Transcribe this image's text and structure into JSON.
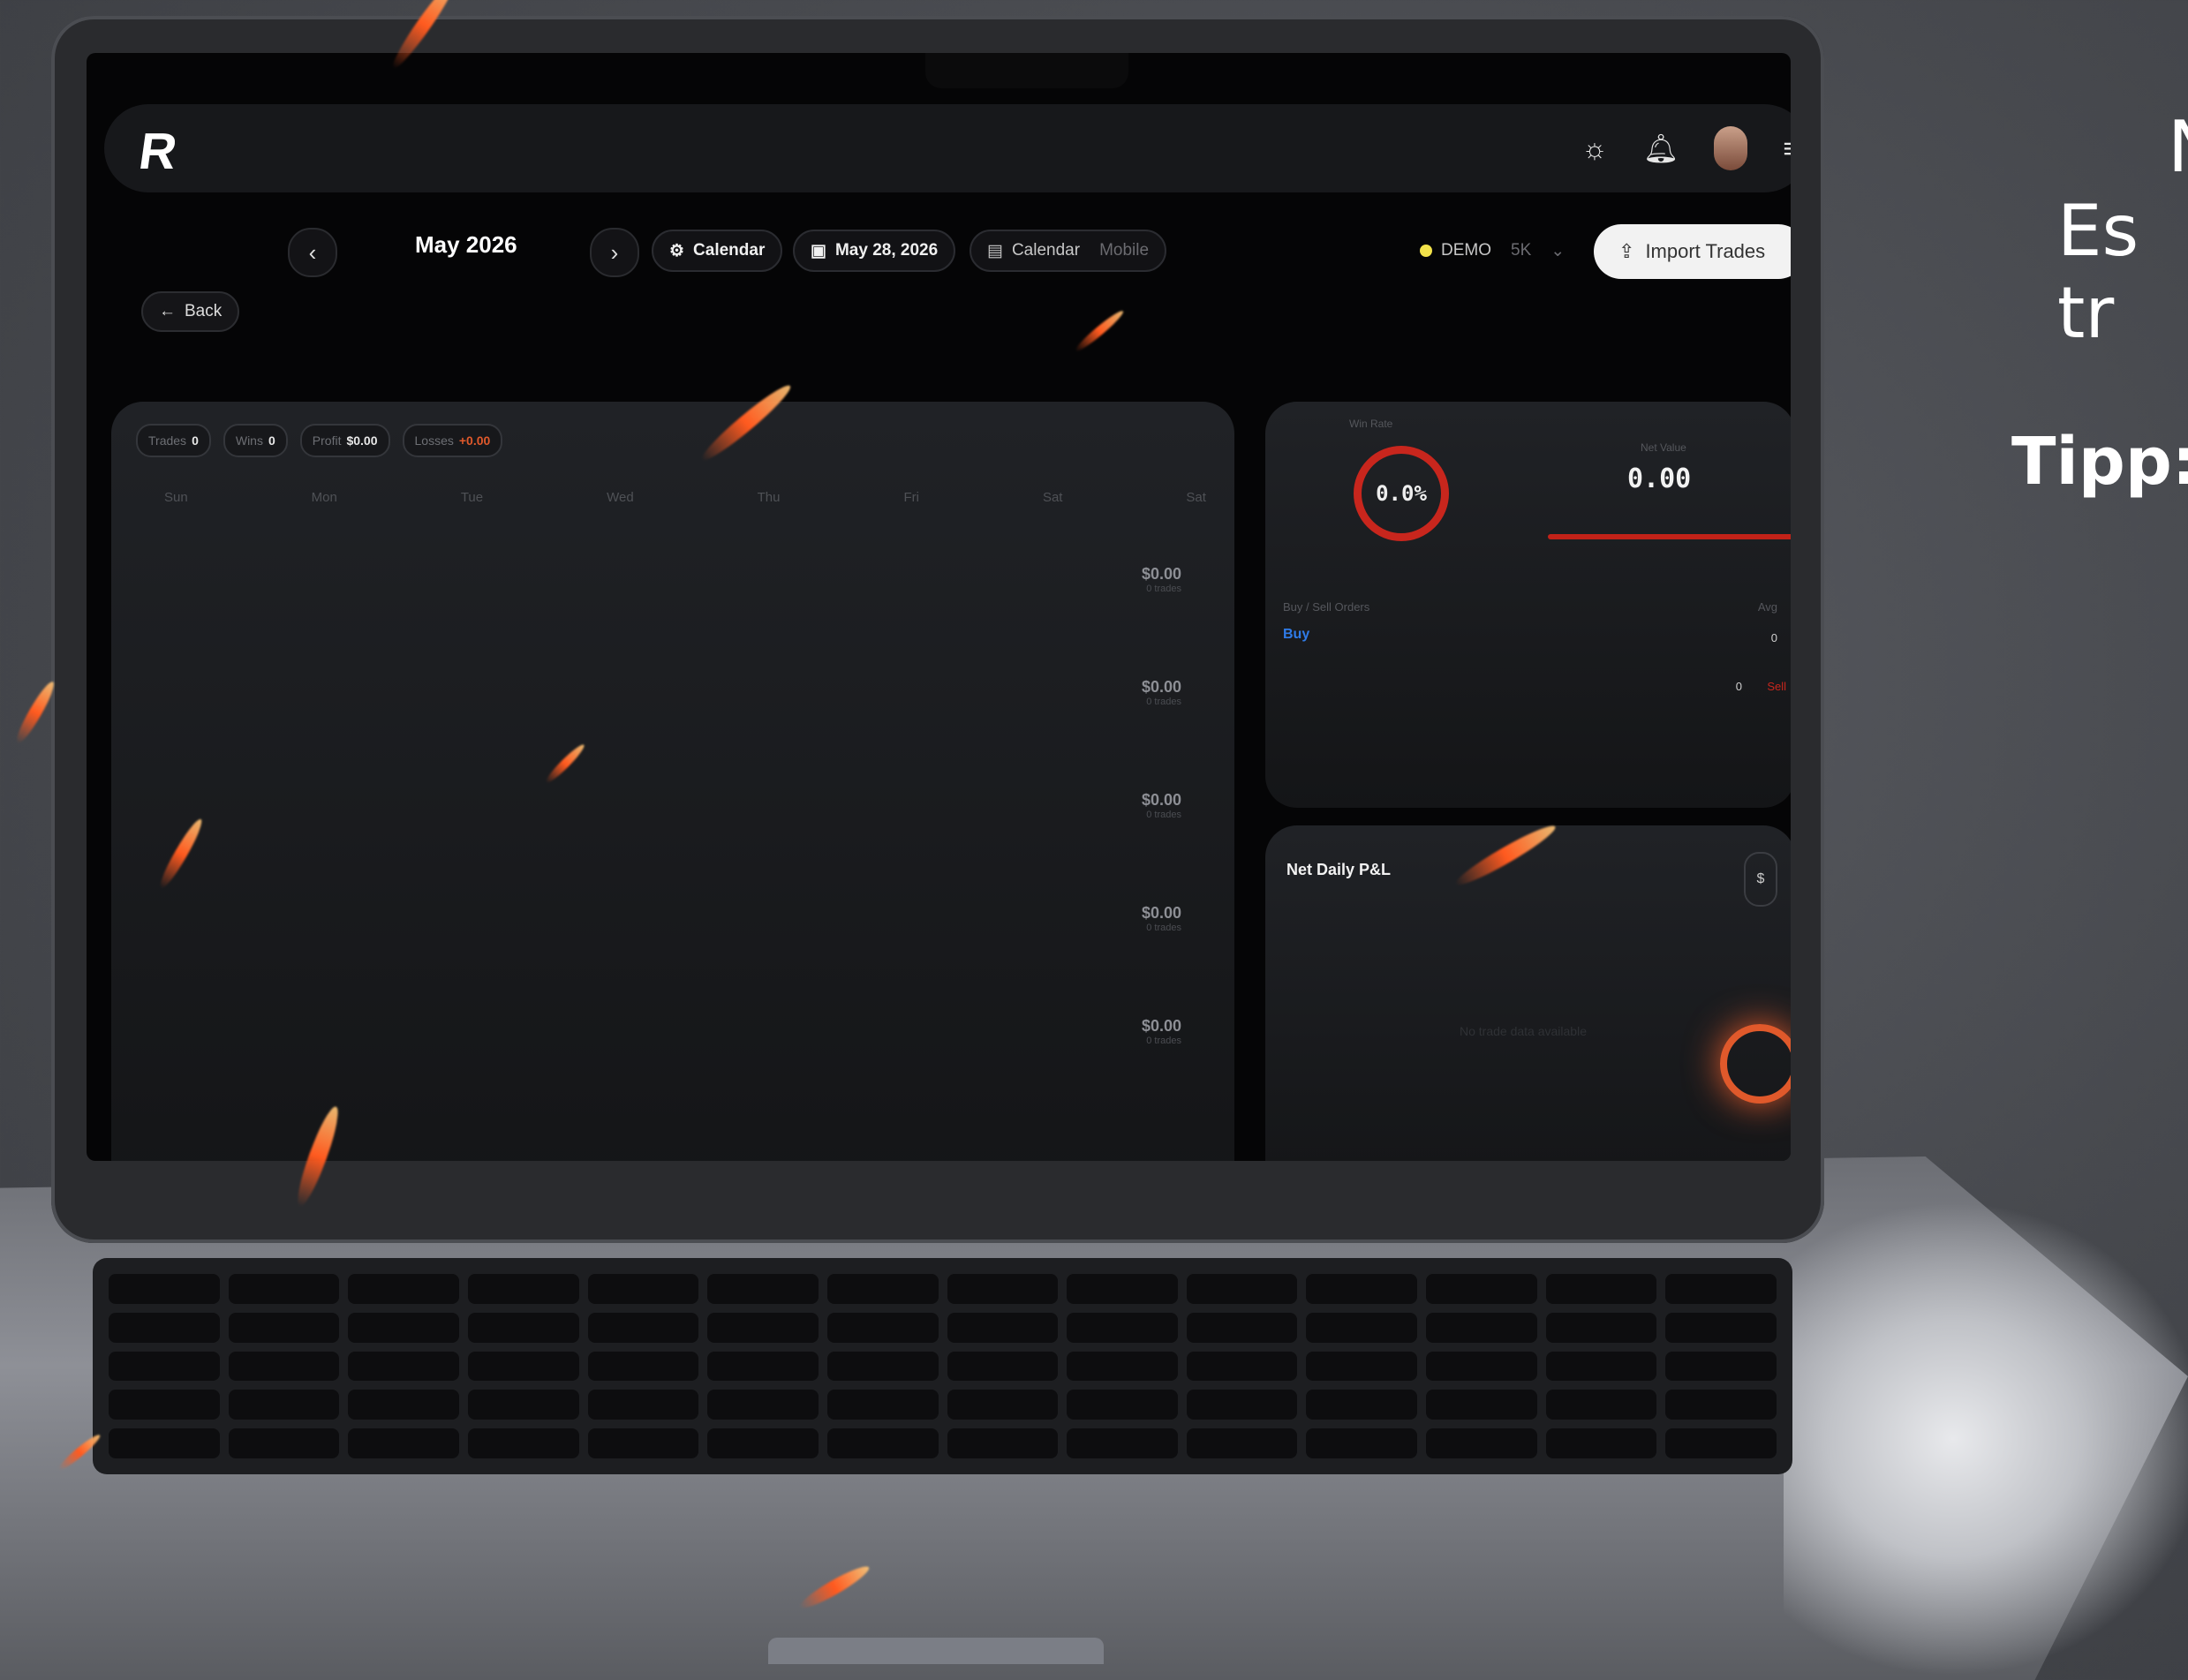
{
  "side_text": {
    "line1": "N",
    "line2": "Es tr",
    "tip": "Tipp:"
  },
  "app": {
    "logo": "R",
    "top_icons": [
      "sun-icon",
      "bell-icon",
      "avatar",
      "menu-icon"
    ],
    "nav": {
      "prev": "‹",
      "month": "May 2026",
      "next": "›",
      "calendar_label": "Calendar",
      "date_label": "May 28, 2026",
      "view_calendar": "Calendar",
      "view_mobile": "Mobile",
      "account": "DEMO",
      "account_extra": "5K",
      "import_label": "Import Trades",
      "back_label": "Back"
    },
    "calendar": {
      "stats": [
        {
          "label": "Trades",
          "value": "0"
        },
        {
          "label": "Wins",
          "value": "0"
        },
        {
          "label": "Profit",
          "value": "$0.00"
        },
        {
          "label": "Losses",
          "value": "+0.00"
        }
      ],
      "weekdays": [
        "Sun",
        "Mon",
        "Tue",
        "Wed",
        "Thu",
        "Fri",
        "Sat",
        "Sat"
      ],
      "week_totals": [
        "$0.00",
        "$0.00",
        "$0.00",
        "$0.00",
        "$0.00"
      ],
      "week_sub": "0 trades"
    },
    "overview": {
      "ring_caption": "Win Rate",
      "ring_value": "0.0%",
      "num_caption": "Net Value",
      "num_value": "0.00",
      "section_label": "Buy / Sell Orders",
      "buy_label": "Buy",
      "right_caption": "Avg",
      "row1": "0",
      "row2": "0",
      "sell_label": "Sell"
    },
    "pnl": {
      "title": "Net Daily P&L",
      "chip": "$",
      "empty": "No trade data available"
    }
  },
  "colors": {
    "accent_red": "#c8261d",
    "spark_orange": "#ff5a1f",
    "buy_blue": "#2f7be8",
    "demo_yellow": "#f2e24a"
  }
}
